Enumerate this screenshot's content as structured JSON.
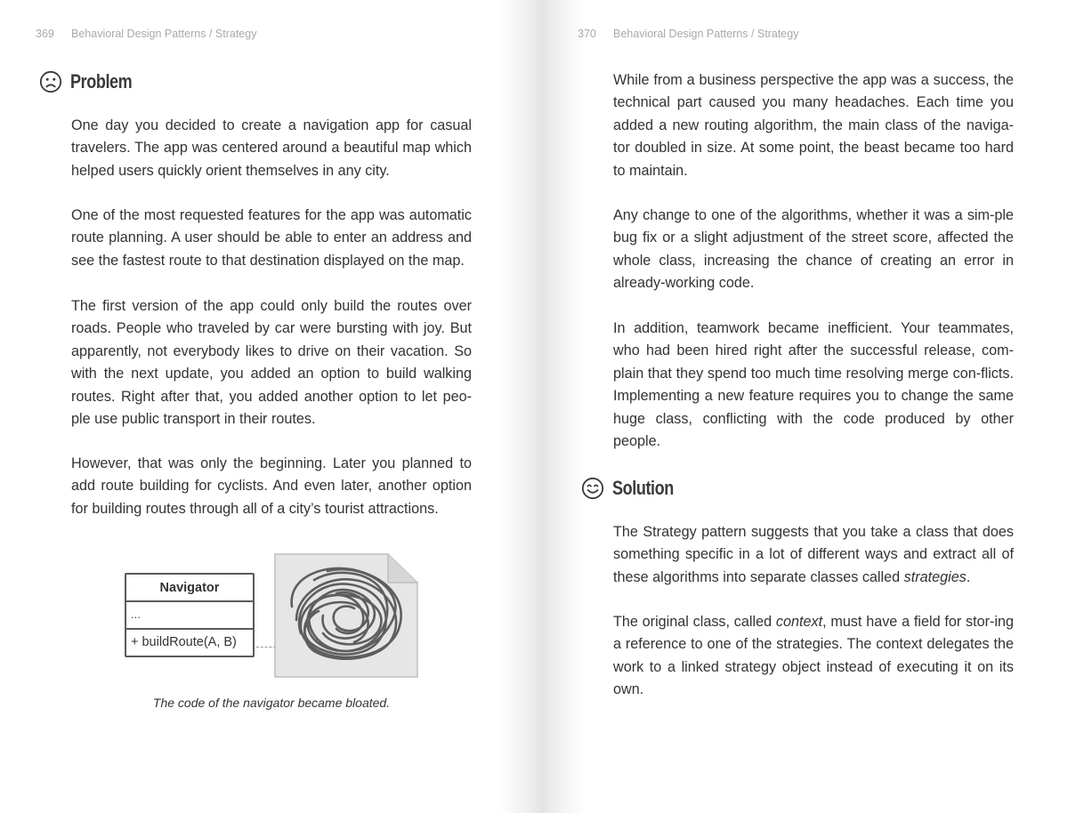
{
  "left_page": {
    "running_head": {
      "page_number": "369",
      "title": "Behavioral Design Patterns / Strategy"
    },
    "section": {
      "icon": "sad-face-icon",
      "heading": "Problem"
    },
    "paragraphs": [
      "One day you decided to create a navigation app for casual travelers. The app was centered around a beautiful map which helped users quickly orient themselves in any city.",
      "One of the most requested features for the app was automatic route planning. A user should be able to enter an address and see the fastest route to that destination displayed on the map.",
      "The first version of the app could only build the routes over roads. People who traveled by car were bursting with joy. But apparently, not everybody likes to drive on their vacation. So with the next update, you added an option to build walking routes. Right after that, you added another option to let peo-ple use public transport in their routes.",
      "However, that was only the beginning. Later you planned to add route building for cyclists. And even later, another option for building routes through all of a city’s tourist attractions."
    ],
    "figure": {
      "class_name": "Navigator",
      "fields": "...",
      "method": "+ buildRoute(A, B)",
      "caption": "The code of the navigator became bloated."
    }
  },
  "right_page": {
    "running_head": {
      "page_number": "370",
      "title": "Behavioral Design Patterns / Strategy"
    },
    "paragraphs": [
      "While from a business perspective the app was a success, the technical part caused you many headaches. Each time you added a new routing algorithm, the main class of the naviga-tor doubled in size. At some point, the beast became too hard to maintain.",
      "Any change to one of the algorithms, whether it was a sim-ple bug fix or a slight adjustment of the street score, affected the whole class, increasing the chance of creating an error in already-working code.",
      "In addition, teamwork became inefficient. Your teammates, who had been hired right after the successful release, com-plain that they spend too much time resolving merge con-flicts. Implementing a new feature requires you to change the same huge class, conflicting with the code produced by other people."
    ],
    "section": {
      "icon": "smile-face-icon",
      "heading": "Solution"
    },
    "solution_p1": {
      "before": "The Strategy pattern suggests that you take a class that does something specific in a lot of different ways and extract all of these algorithms into separate classes called ",
      "em": "strategies",
      "after": "."
    },
    "solution_p2": {
      "before": "The original class, called ",
      "em": "context",
      "after": ", must have a field for stor-ing a reference to one of the strategies. The context delegates the work to a linked strategy object instead of executing it on its own."
    }
  }
}
